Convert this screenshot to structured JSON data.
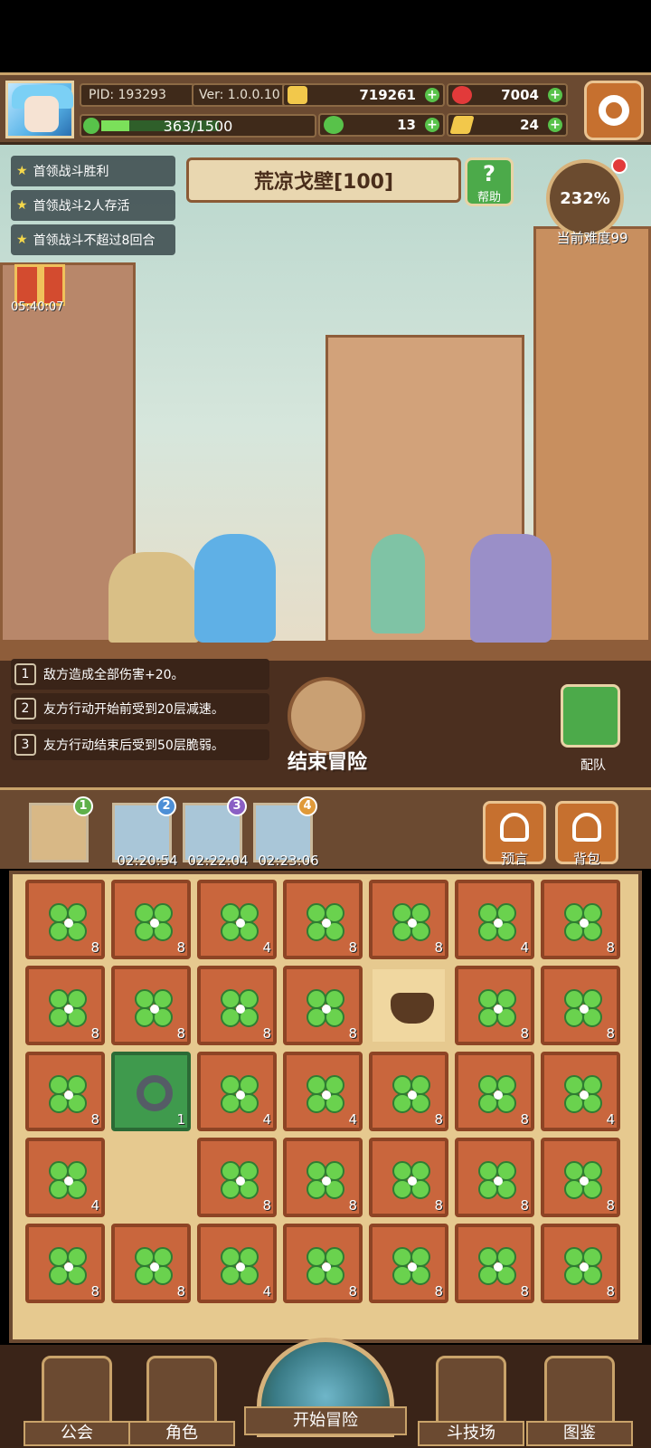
{
  "header": {
    "pid": "PID: 193293",
    "version": "Ver: 1.0.0.10",
    "gold": "719261",
    "gems": "7004",
    "exp_text": "363/1500",
    "exp_progress": 0.242,
    "clovers": "13",
    "keys": "24"
  },
  "missions": [
    "首领战斗胜利",
    "首领战斗2人存活",
    "首领战斗不超过8回合"
  ],
  "stage": {
    "name": "荒凉戈壁[100]",
    "help_label": "帮助",
    "difficulty_percent": "232%",
    "difficulty_label": "当前难度99",
    "gift_timer": "05:40:07"
  },
  "rules": [
    {
      "num": "1",
      "text": "敌方造成全部伤害+20。"
    },
    {
      "num": "2",
      "text": "友方行动开始前受到20层减速。"
    },
    {
      "num": "3",
      "text": "友方行动结束后受到50层脆弱。"
    }
  ],
  "end_adventure_label": "结束冒险",
  "team_label": "配队",
  "slots": [
    {
      "badge": "1",
      "time": ""
    },
    {
      "badge": "2",
      "time": "02:20:54"
    },
    {
      "badge": "3",
      "time": "02:22:04"
    },
    {
      "badge": "4",
      "time": "02:23:06"
    }
  ],
  "prophecy_label": "预言",
  "backpack_label": "背包",
  "inventory": [
    {
      "kind": "clover",
      "count": "8"
    },
    {
      "kind": "clover",
      "count": "8"
    },
    {
      "kind": "clover",
      "count": "4"
    },
    {
      "kind": "clover",
      "count": "8"
    },
    {
      "kind": "clover",
      "count": "8"
    },
    {
      "kind": "clover",
      "count": "4"
    },
    {
      "kind": "clover",
      "count": "8"
    },
    {
      "kind": "clover",
      "count": "8"
    },
    {
      "kind": "clover",
      "count": "8"
    },
    {
      "kind": "clover",
      "count": "8"
    },
    {
      "kind": "clover",
      "count": "8"
    },
    {
      "kind": "pot",
      "count": ""
    },
    {
      "kind": "clover",
      "count": "8"
    },
    {
      "kind": "clover",
      "count": "8"
    },
    {
      "kind": "clover",
      "count": "8"
    },
    {
      "kind": "ring",
      "count": "1"
    },
    {
      "kind": "clover",
      "count": "4"
    },
    {
      "kind": "clover",
      "count": "4"
    },
    {
      "kind": "clover",
      "count": "8"
    },
    {
      "kind": "clover",
      "count": "8"
    },
    {
      "kind": "clover",
      "count": "4"
    },
    {
      "kind": "clover",
      "count": "4"
    },
    {
      "kind": "empty",
      "count": ""
    },
    {
      "kind": "clover",
      "count": "8"
    },
    {
      "kind": "clover",
      "count": "8"
    },
    {
      "kind": "clover",
      "count": "8"
    },
    {
      "kind": "clover",
      "count": "8"
    },
    {
      "kind": "clover",
      "count": "8"
    },
    {
      "kind": "clover",
      "count": "8"
    },
    {
      "kind": "clover",
      "count": "8"
    },
    {
      "kind": "clover",
      "count": "4"
    },
    {
      "kind": "clover",
      "count": "8"
    },
    {
      "kind": "clover",
      "count": "8"
    },
    {
      "kind": "clover",
      "count": "8"
    },
    {
      "kind": "clover",
      "count": "8"
    }
  ],
  "nav": {
    "guild": "公会",
    "character": "角色",
    "start": "开始冒险",
    "arena": "斗技场",
    "codex": "图鉴"
  },
  "colors": {
    "panel_brown": "#6b4a31",
    "accent_green": "#4caa4a",
    "cell_orange": "#c9663d"
  }
}
